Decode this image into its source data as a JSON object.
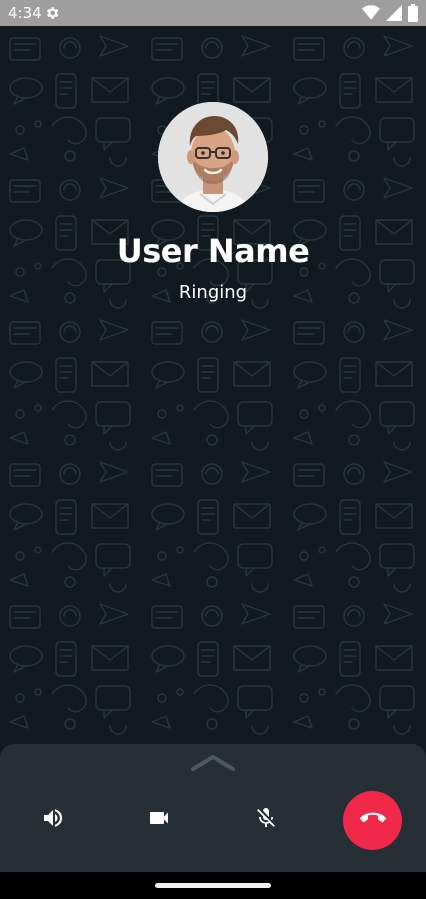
{
  "status_bar": {
    "time": "4:34",
    "icons": [
      "settings-icon",
      "wifi-icon",
      "signal-icon",
      "battery-icon"
    ]
  },
  "call": {
    "user_name": "User Name",
    "status": "Ringing"
  },
  "controls": {
    "items": [
      "speaker-icon",
      "video-icon",
      "mic-off-icon",
      "end-call-icon"
    ]
  },
  "colors": {
    "background": "#101a20",
    "panel": "#252f35",
    "end_call": "#f0284a",
    "status_bar": "#9e9e9e"
  }
}
